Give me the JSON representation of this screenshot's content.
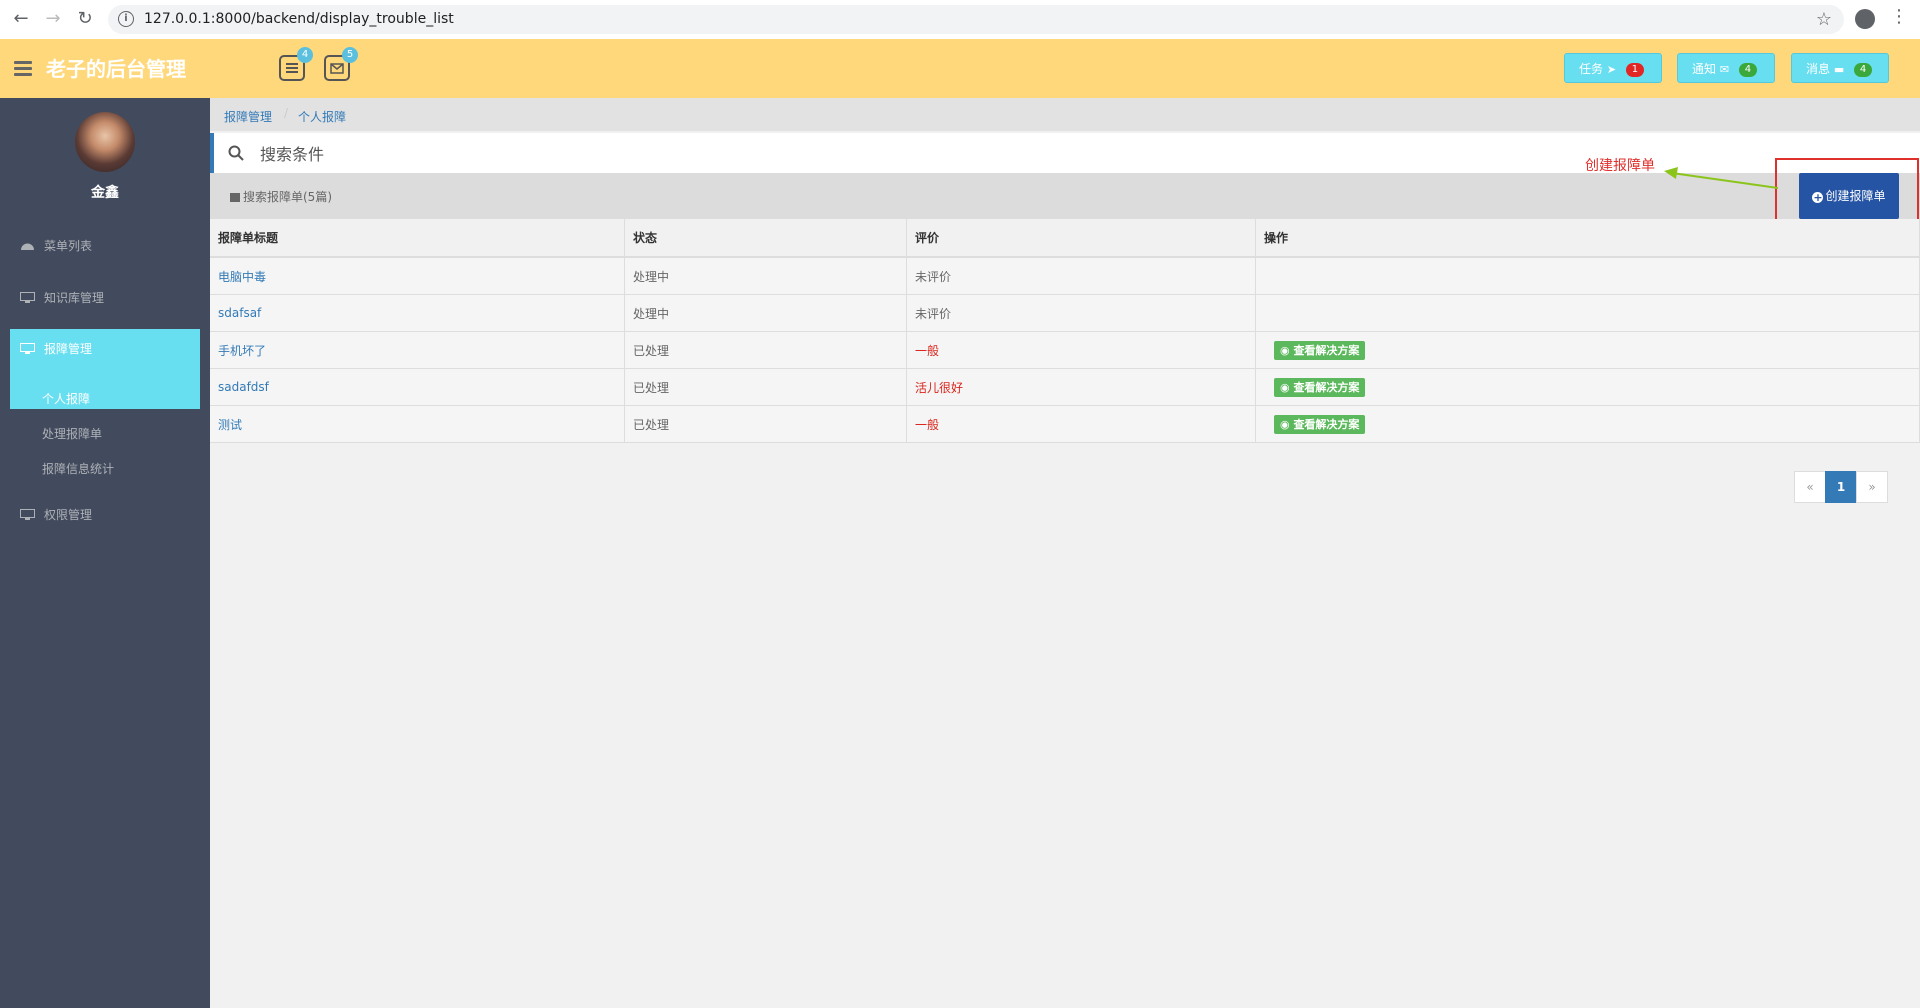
{
  "browser": {
    "url": "127.0.0.1:8000/backend/display_trouble_list"
  },
  "header": {
    "brand": "老子的后台管理",
    "list_badge": "4",
    "mail_badge": "5",
    "buttons": [
      {
        "label": "任务",
        "count": "1",
        "count_color": "#e22626"
      },
      {
        "label": "通知",
        "count": "4",
        "count_color": "#3aa83a"
      },
      {
        "label": "消息",
        "count": "4",
        "count_color": "#3aa83a"
      }
    ]
  },
  "sidebar": {
    "user_name": "金鑫",
    "items": [
      {
        "label": "菜单列表"
      },
      {
        "label": "知识库管理"
      },
      {
        "label": "报障管理"
      },
      {
        "label": "权限管理"
      }
    ],
    "sub_items": [
      {
        "label": "个人报障"
      },
      {
        "label": "处理报障单"
      },
      {
        "label": "报障信息统计"
      }
    ]
  },
  "breadcrumb": [
    "报障管理",
    "个人报障"
  ],
  "search": {
    "placeholder": "搜索条件"
  },
  "panel": {
    "title": "搜索报障单(5篇)",
    "create_label": "创建报障单"
  },
  "annotation": {
    "text": "创建报障单"
  },
  "table": {
    "columns": [
      "报障单标题",
      "状态",
      "评价",
      "操作"
    ],
    "rows": [
      {
        "title": "电脑中毒",
        "status": "处理中",
        "rating": "未评价",
        "action": ""
      },
      {
        "title": "sdafsaf",
        "status": "处理中",
        "rating": "未评价",
        "action": ""
      },
      {
        "title": "手机坏了",
        "status": "已处理",
        "rating": "一般",
        "action": "查看解决方案"
      },
      {
        "title": "sadafdsf",
        "status": "已处理",
        "rating": "活儿很好",
        "action": "查看解决方案"
      },
      {
        "title": "测试",
        "status": "已处理",
        "rating": "一般",
        "action": "查看解决方案"
      }
    ]
  },
  "pagination": {
    "prev": "«",
    "current": "1",
    "next": "»"
  }
}
